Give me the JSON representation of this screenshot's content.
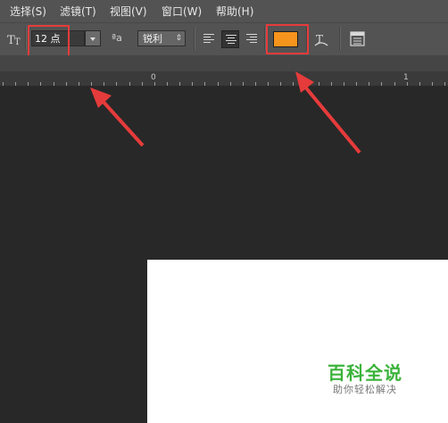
{
  "menu": [
    "选择(S)",
    "滤镜(T)",
    "视图(V)",
    "窗口(W)",
    "帮助(H)"
  ],
  "options": {
    "font_size": "12 点",
    "aa_icon_text": "ªa",
    "antialias": "锐利",
    "text_color": "#f7941d"
  },
  "ruler": {
    "labels": [
      "0",
      "1"
    ]
  },
  "watermark": {
    "title": "百科全说",
    "subtitle": "助你轻松解决"
  },
  "colors": {
    "highlight": "#e63b3b",
    "arrow": "#e63b3b"
  }
}
